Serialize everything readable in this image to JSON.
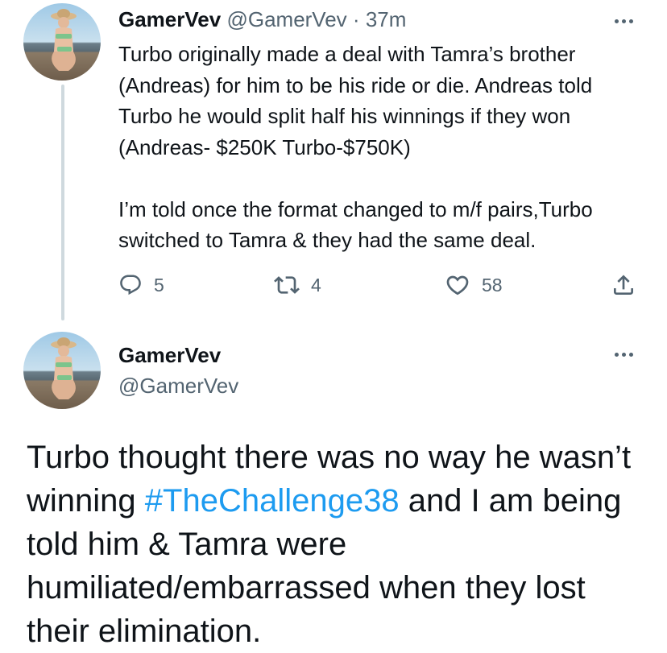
{
  "tweet1": {
    "display_name": "GamerVev",
    "handle": "@GamerVev",
    "separator": "·",
    "time": "37m",
    "text": "Turbo originally made a deal with Tamra’s brother (Andreas) for him to be his ride or die. Andreas told Turbo he would split half his winnings if they won (Andreas- $250K Turbo-$750K)\n\nI’m told once the format changed to m/f pairs,Turbo switched to Tamra & they had the same deal.",
    "replies": "5",
    "retweets": "4",
    "likes": "58"
  },
  "tweet2": {
    "display_name": "GamerVev",
    "handle": "@GamerVev",
    "text_before": "Turbo thought there was no way he wasn’t winning ",
    "hashtag": "#TheChallenge38",
    "text_after": " and I am being told him & Tamra were humiliated/embarrassed when they lost their elimination."
  },
  "icons": {
    "more": "more-dots-icon",
    "reply": "reply-icon",
    "retweet": "retweet-icon",
    "like": "heart-icon",
    "share": "share-icon"
  },
  "colors": {
    "text": "#0f1419",
    "secondary": "#536471",
    "link": "#1d9bf0",
    "thread_line": "#cfd9de"
  }
}
